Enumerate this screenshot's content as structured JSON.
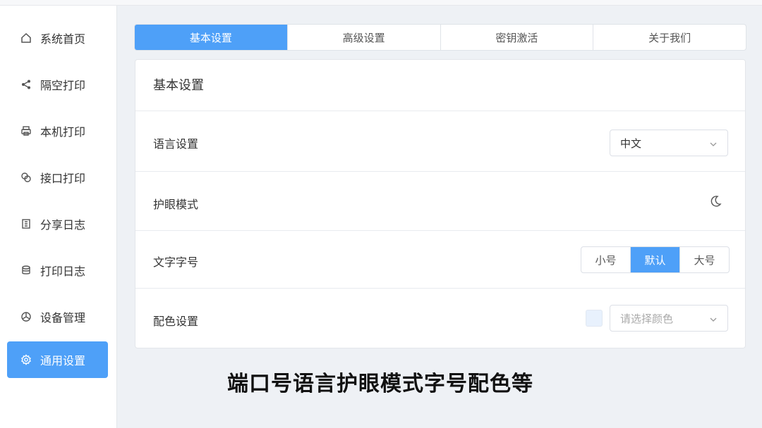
{
  "sidebar": {
    "items": [
      {
        "label": "系统首页",
        "icon": "home-icon"
      },
      {
        "label": "隔空打印",
        "icon": "share-icon"
      },
      {
        "label": "本机打印",
        "icon": "printer-icon"
      },
      {
        "label": "接口打印",
        "icon": "link-icon"
      },
      {
        "label": "分享日志",
        "icon": "document-icon"
      },
      {
        "label": "打印日志",
        "icon": "database-icon"
      },
      {
        "label": "设备管理",
        "icon": "dashboard-icon"
      },
      {
        "label": "通用设置",
        "icon": "gear-icon"
      }
    ],
    "active_index": 7
  },
  "tabs": {
    "items": [
      "基本设置",
      "高级设置",
      "密钥激活",
      "关于我们"
    ],
    "active_index": 0
  },
  "panel": {
    "title": "基本设置",
    "language": {
      "label": "语言设置",
      "value": "中文"
    },
    "eye_mode": {
      "label": "护眼模式",
      "icon": "moon-icon"
    },
    "font_size": {
      "label": "文字字号",
      "options": [
        "小号",
        "默认",
        "大号"
      ],
      "selected": "默认"
    },
    "color": {
      "label": "配色设置",
      "placeholder": "请选择颜色",
      "swatch_color": "#e8f1fd"
    }
  },
  "caption": "端口号语言护眼模式字号配色等",
  "colors": {
    "accent": "#4ea0f8",
    "background": "#eef1f5"
  }
}
